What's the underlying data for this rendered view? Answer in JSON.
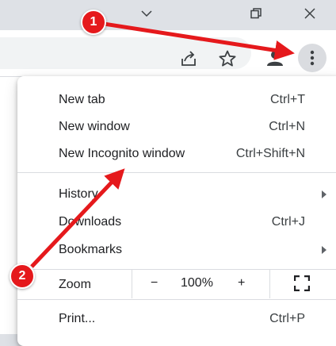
{
  "window_controls": {
    "chevron_icon": "chevron-down-icon",
    "restore_icon": "restore-icon",
    "close_icon": "close-icon"
  },
  "toolbar": {
    "share_icon": "share-icon",
    "bookmark_icon": "star-icon",
    "profile_icon": "profile-icon",
    "menu_icon": "kebab-menu-icon"
  },
  "menu": {
    "items": [
      {
        "label": "New tab",
        "shortcut": "Ctrl+T"
      },
      {
        "label": "New window",
        "shortcut": "Ctrl+N"
      },
      {
        "label": "New Incognito window",
        "shortcut": "Ctrl+Shift+N"
      },
      {
        "label": "History",
        "shortcut": ""
      },
      {
        "label": "Downloads",
        "shortcut": "Ctrl+J"
      },
      {
        "label": "Bookmarks",
        "shortcut": ""
      },
      {
        "label": "Print...",
        "shortcut": "Ctrl+P"
      }
    ],
    "zoom": {
      "label": "Zoom",
      "minus": "−",
      "value": "100%",
      "plus": "+",
      "fullscreen_icon": "fullscreen-icon"
    }
  },
  "annotations": {
    "marker_1": "1",
    "marker_2": "2",
    "color": "#e5191c"
  }
}
